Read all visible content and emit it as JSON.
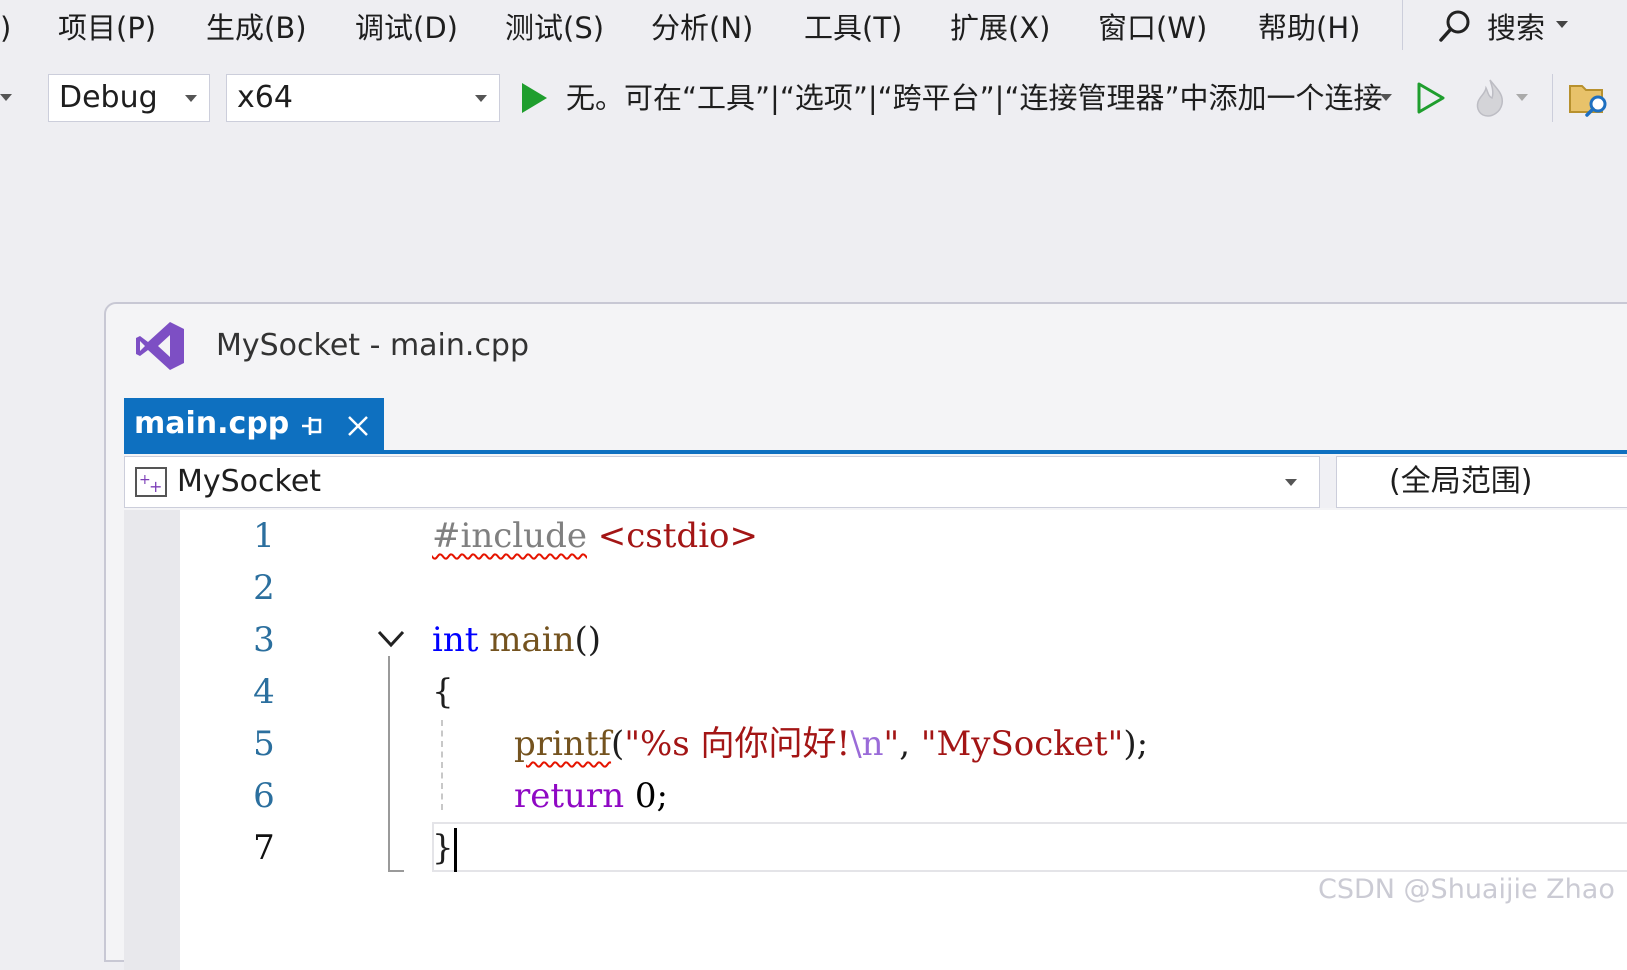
{
  "menu": {
    "partial_item": ")",
    "items": [
      "项目(P)",
      "生成(B)",
      "调试(D)",
      "测试(S)",
      "分析(N)",
      "工具(T)",
      "扩展(X)",
      "窗口(W)",
      "帮助(H)"
    ],
    "search_label": "搜索"
  },
  "toolbar": {
    "configuration": "Debug",
    "platform": "x64",
    "connection_text": "无。可在“工具”|“选项”|“跨平台”|“连接管理器”中添加一个连接"
  },
  "window": {
    "title": "MySocket - main.cpp"
  },
  "tab": {
    "label": "main.cpp"
  },
  "navigation": {
    "project": "MySocket",
    "scope": "(全局范围)"
  },
  "code": {
    "line_numbers": [
      "1",
      "2",
      "3",
      "4",
      "5",
      "6",
      "7"
    ],
    "line1": {
      "directive": "#include",
      "header": "<cstdio>"
    },
    "line3": {
      "type": "int",
      "name": "main",
      "parens": "()"
    },
    "line4": {
      "brace": "{"
    },
    "line5": {
      "func": "printf",
      "open": "(",
      "str1_start": "\"%s 向你问好!",
      "str1_escape": "\\n",
      "str1_end": "\"",
      "comma": ", ",
      "str2": "\"MySocket\"",
      "close": ");"
    },
    "line6": {
      "keyword": "return",
      "value": "0;"
    },
    "line7": {
      "brace": "}"
    }
  },
  "watermark": "CSDN @Shuaijie Zhao",
  "colors": {
    "accent": "#0e70c0",
    "keyword": "#0000ff",
    "string": "#a31515",
    "function": "#74531f",
    "control_keyword": "#8f08c4",
    "run_green": "#1f9e2e",
    "vs_purple": "#7d4fc4",
    "error_squiggle": "#e51400"
  }
}
